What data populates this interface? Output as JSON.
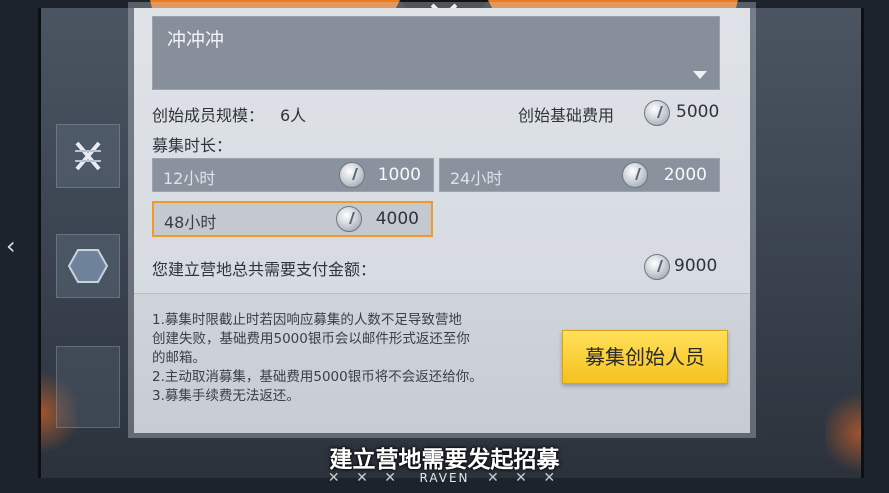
{
  "camp_name": "冲冲冲",
  "founder_scale": {
    "label": "创始成员规模：",
    "value": "6人"
  },
  "base_fee": {
    "label": "创始基础费用",
    "value": "5000"
  },
  "duration": {
    "label": "募集时长：",
    "options": [
      {
        "label": "12小时",
        "cost": "1000",
        "selected": false
      },
      {
        "label": "24小时",
        "cost": "2000",
        "selected": false
      },
      {
        "label": "48小时",
        "cost": "4000",
        "selected": true
      }
    ]
  },
  "total": {
    "label": "您建立营地总共需要支付金额：",
    "value": "9000"
  },
  "notes": [
    "1.募集时限截止时若因响应募集的人数不足导致营地",
    "创建失败，基础费用5000银币会以邮件形式返还至你",
    "的邮箱。",
    "2.主动取消募集，基础费用5000银币将不会返还给你。",
    "3.募集手续费无法返还。"
  ],
  "recruit_button": "募集创始人员",
  "caption": "建立营地需要发起招募",
  "brand": {
    "left": "✕ ✕ ✕",
    "name": "RAVEN",
    "right": "✕ ✕ ✕"
  },
  "icons": {
    "back": "chevron-left-icon",
    "rail_1": "crossed-x-emblem-icon",
    "rail_2": "hexagon-icon",
    "coin": "silver-coin-icon",
    "dropdown": "caret-down-icon"
  },
  "colors": {
    "accent": "#ee7d1e",
    "button": "#f5c21f",
    "selected_border": "#f09a2a"
  }
}
